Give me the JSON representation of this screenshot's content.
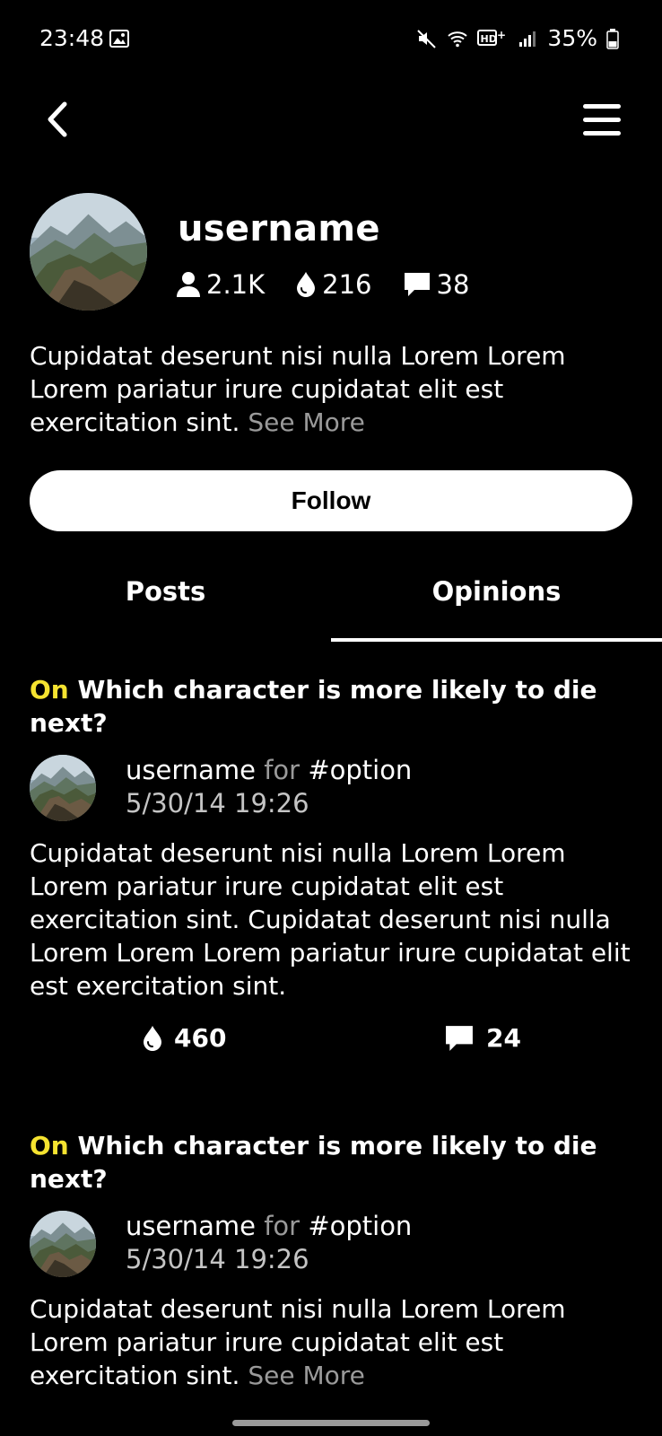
{
  "status_bar": {
    "time": "23:48",
    "battery": "35%",
    "icons": [
      "gallery-icon",
      "mute-icon",
      "wifi-icon",
      "hd-plus-icon",
      "signal-icon",
      "battery-icon"
    ]
  },
  "header": {
    "back_icon": "chevron-left-icon",
    "menu_icon": "hamburger-menu-icon"
  },
  "profile": {
    "username": "username",
    "followers": "2.1K",
    "drops": "216",
    "comments": "38",
    "bio": "Cupidatat deserunt nisi nulla Lorem Lorem Lorem pariatur irure cupidatat elit est exercitation sint.",
    "see_more": "See More",
    "follow_label": "Follow"
  },
  "tabs": [
    {
      "label": "Posts",
      "active": false
    },
    {
      "label": "Opinions",
      "active": true
    }
  ],
  "opinions": [
    {
      "on_label": "On",
      "question": "Which character is more likely to die next?",
      "username": "username",
      "for_label": "for",
      "option": "#option",
      "date": "5/30/14 19:26",
      "body": "Cupidatat deserunt nisi nulla Lorem Lorem Lorem pariatur irure cupidatat elit est exercitation sint. Cupidatat deserunt nisi nulla Lorem Lorem Lorem pariatur irure cupidatat elit est exercitation sint.",
      "drops": "460",
      "comments": "24"
    },
    {
      "on_label": "On",
      "question": "Which character is more likely to die next?",
      "username": "username",
      "for_label": "for",
      "option": "#option",
      "date": "5/30/14 19:26",
      "body": "Cupidatat deserunt nisi nulla Lorem Lorem Lorem pariatur irure cupidatat elit est exercitation sint.",
      "see_more": "See More"
    }
  ],
  "colors": {
    "background": "#000000",
    "accent_on": "#f5e330",
    "muted_text": "#9a9a9a"
  }
}
